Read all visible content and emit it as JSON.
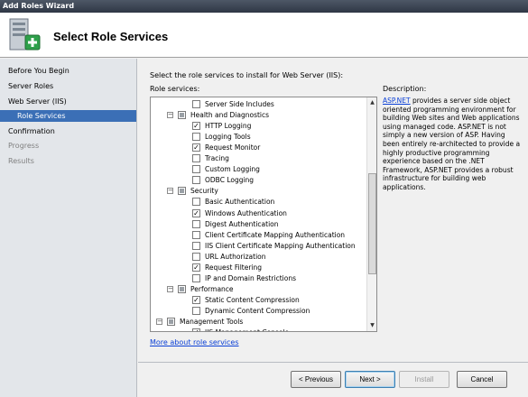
{
  "window": {
    "title": "Add Roles Wizard"
  },
  "header": {
    "title": "Select Role Services",
    "icon": "server-add-icon"
  },
  "sidebar": {
    "items": [
      {
        "label": "Before You Begin",
        "state": "normal"
      },
      {
        "label": "Server Roles",
        "state": "normal"
      },
      {
        "label": "Web Server (IIS)",
        "state": "normal"
      },
      {
        "label": "Role Services",
        "state": "selected"
      },
      {
        "label": "Confirmation",
        "state": "normal"
      },
      {
        "label": "Progress",
        "state": "disabled"
      },
      {
        "label": "Results",
        "state": "disabled"
      }
    ]
  },
  "main": {
    "instruction": "Select the role services to install for Web Server (IIS):",
    "services_label": "Role services:",
    "description_label": "Description:",
    "tree": [
      {
        "label": "Server Side Includes",
        "type": "leaf",
        "checked": false
      },
      {
        "label": "Health and Diagnostics",
        "type": "group",
        "checked": "partial"
      },
      {
        "label": "HTTP Logging",
        "type": "leaf",
        "checked": true
      },
      {
        "label": "Logging Tools",
        "type": "leaf",
        "checked": false
      },
      {
        "label": "Request Monitor",
        "type": "leaf",
        "checked": true
      },
      {
        "label": "Tracing",
        "type": "leaf",
        "checked": false
      },
      {
        "label": "Custom Logging",
        "type": "leaf",
        "checked": false
      },
      {
        "label": "ODBC Logging",
        "type": "leaf",
        "checked": false
      },
      {
        "label": "Security",
        "type": "group",
        "checked": "partial"
      },
      {
        "label": "Basic Authentication",
        "type": "leaf",
        "checked": false
      },
      {
        "label": "Windows Authentication",
        "type": "leaf",
        "checked": true
      },
      {
        "label": "Digest Authentication",
        "type": "leaf",
        "checked": false
      },
      {
        "label": "Client Certificate Mapping Authentication",
        "type": "leaf",
        "checked": false
      },
      {
        "label": "IIS Client Certificate Mapping Authentication",
        "type": "leaf",
        "checked": false
      },
      {
        "label": "URL Authorization",
        "type": "leaf",
        "checked": false
      },
      {
        "label": "Request Filtering",
        "type": "leaf",
        "checked": true
      },
      {
        "label": "IP and Domain Restrictions",
        "type": "leaf",
        "checked": false
      },
      {
        "label": "Performance",
        "type": "group",
        "checked": "partial"
      },
      {
        "label": "Static Content Compression",
        "type": "leaf",
        "checked": true
      },
      {
        "label": "Dynamic Content Compression",
        "type": "leaf",
        "checked": false
      },
      {
        "label": "Management Tools",
        "type": "toplevel",
        "checked": "partial"
      },
      {
        "label": "IIS Management Console",
        "type": "leaf",
        "checked": true
      }
    ],
    "description": {
      "link_text": "ASP.NET",
      "text": " provides a server side object oriented programming environment for building Web sites and Web applications using managed code. ASP.NET is not simply a new version of ASP. Having been entirely re-architected to provide a highly productive programming experience based on the .NET Framework, ASP.NET provides a robust infrastructure for building web applications."
    },
    "more_link": "More about role services"
  },
  "footer": {
    "previous": "< Previous",
    "next": "Next >",
    "install": "Install",
    "cancel": "Cancel"
  },
  "colors": {
    "selection": "#3b6fb6",
    "link": "#0b40d6"
  }
}
